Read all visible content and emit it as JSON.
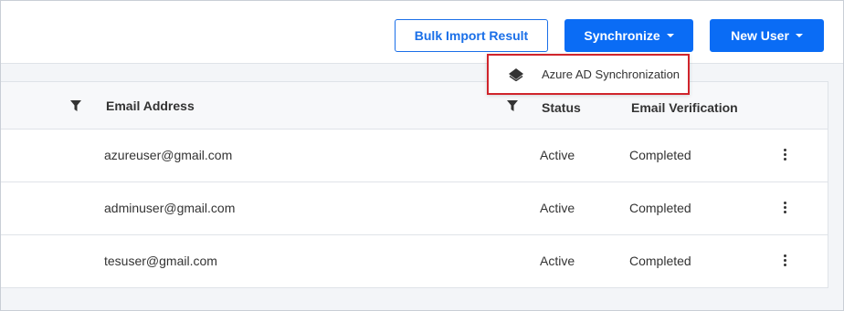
{
  "toolbar": {
    "bulk_import_label": "Bulk Import Result",
    "synchronize_label": "Synchronize",
    "new_user_label": "New User"
  },
  "sync_menu": {
    "items": [
      {
        "label": "Azure AD Synchronization",
        "icon": "layers-icon"
      }
    ]
  },
  "table": {
    "columns": {
      "email": "Email Address",
      "status": "Status",
      "verification": "Email Verification"
    },
    "rows": [
      {
        "email": "azureuser@gmail.com",
        "status": "Active",
        "verification": "Completed"
      },
      {
        "email": "adminuser@gmail.com",
        "status": "Active",
        "verification": "Completed"
      },
      {
        "email": "tesuser@gmail.com",
        "status": "Active",
        "verification": "Completed"
      }
    ]
  },
  "colors": {
    "primary": "#0a6cf5",
    "highlight_border": "#d0242b"
  }
}
